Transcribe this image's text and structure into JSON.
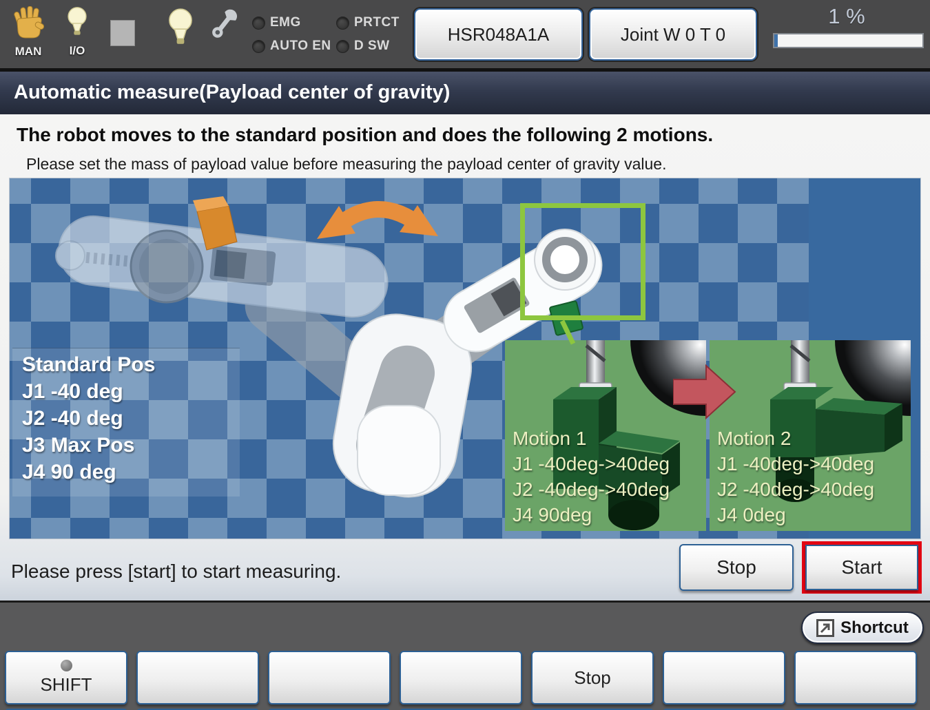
{
  "toolbar": {
    "man_label": "MAN",
    "io_label": "I/O",
    "leds": [
      {
        "label": "EMG"
      },
      {
        "label": "PRTCT"
      },
      {
        "label": "AUTO EN"
      },
      {
        "label": "D SW"
      }
    ],
    "robot_button": "HSR048A1A",
    "mode_button": "Joint  W 0 T 0",
    "override_percent": "1 %"
  },
  "title_bar": {
    "title": "Automatic measure(Payload center of gravity)"
  },
  "content": {
    "heading": "The robot moves to the standard position and does the following 2 motions.",
    "subheading": "Please set the mass of payload value before measuring the payload center of gravity value.",
    "standard_pos": {
      "title": "Standard Pos",
      "lines": [
        "J1 -40 deg",
        "J2 -40 deg",
        "J3 Max Pos",
        "J4 90 deg"
      ]
    },
    "motion1": {
      "title": "Motion 1",
      "lines": [
        "J1 -40deg->40deg",
        "J2 -40deg->40deg",
        "J4 90deg"
      ]
    },
    "motion2": {
      "title": "Motion 2",
      "lines": [
        "J1 -40deg->40deg",
        "J2 -40deg->40deg",
        "J4 0deg"
      ]
    },
    "status_message": "Please press [start] to start measuring.",
    "stop_label": "Stop",
    "start_label": "Start"
  },
  "bottom_bar": {
    "shortcut_label": "Shortcut",
    "fkeys": [
      "SHIFT",
      "",
      "",
      "",
      "Stop",
      "",
      ""
    ]
  },
  "colors": {
    "checker_light": "#6e92b8",
    "checker_dark": "#39669b",
    "panel_green": "#6ba467",
    "highlight_green": "#8dc63f",
    "start_highlight_red": "#e30613",
    "swing_arrow_orange": "#e78e3c",
    "motion_arrow_red": "#c3565e"
  }
}
